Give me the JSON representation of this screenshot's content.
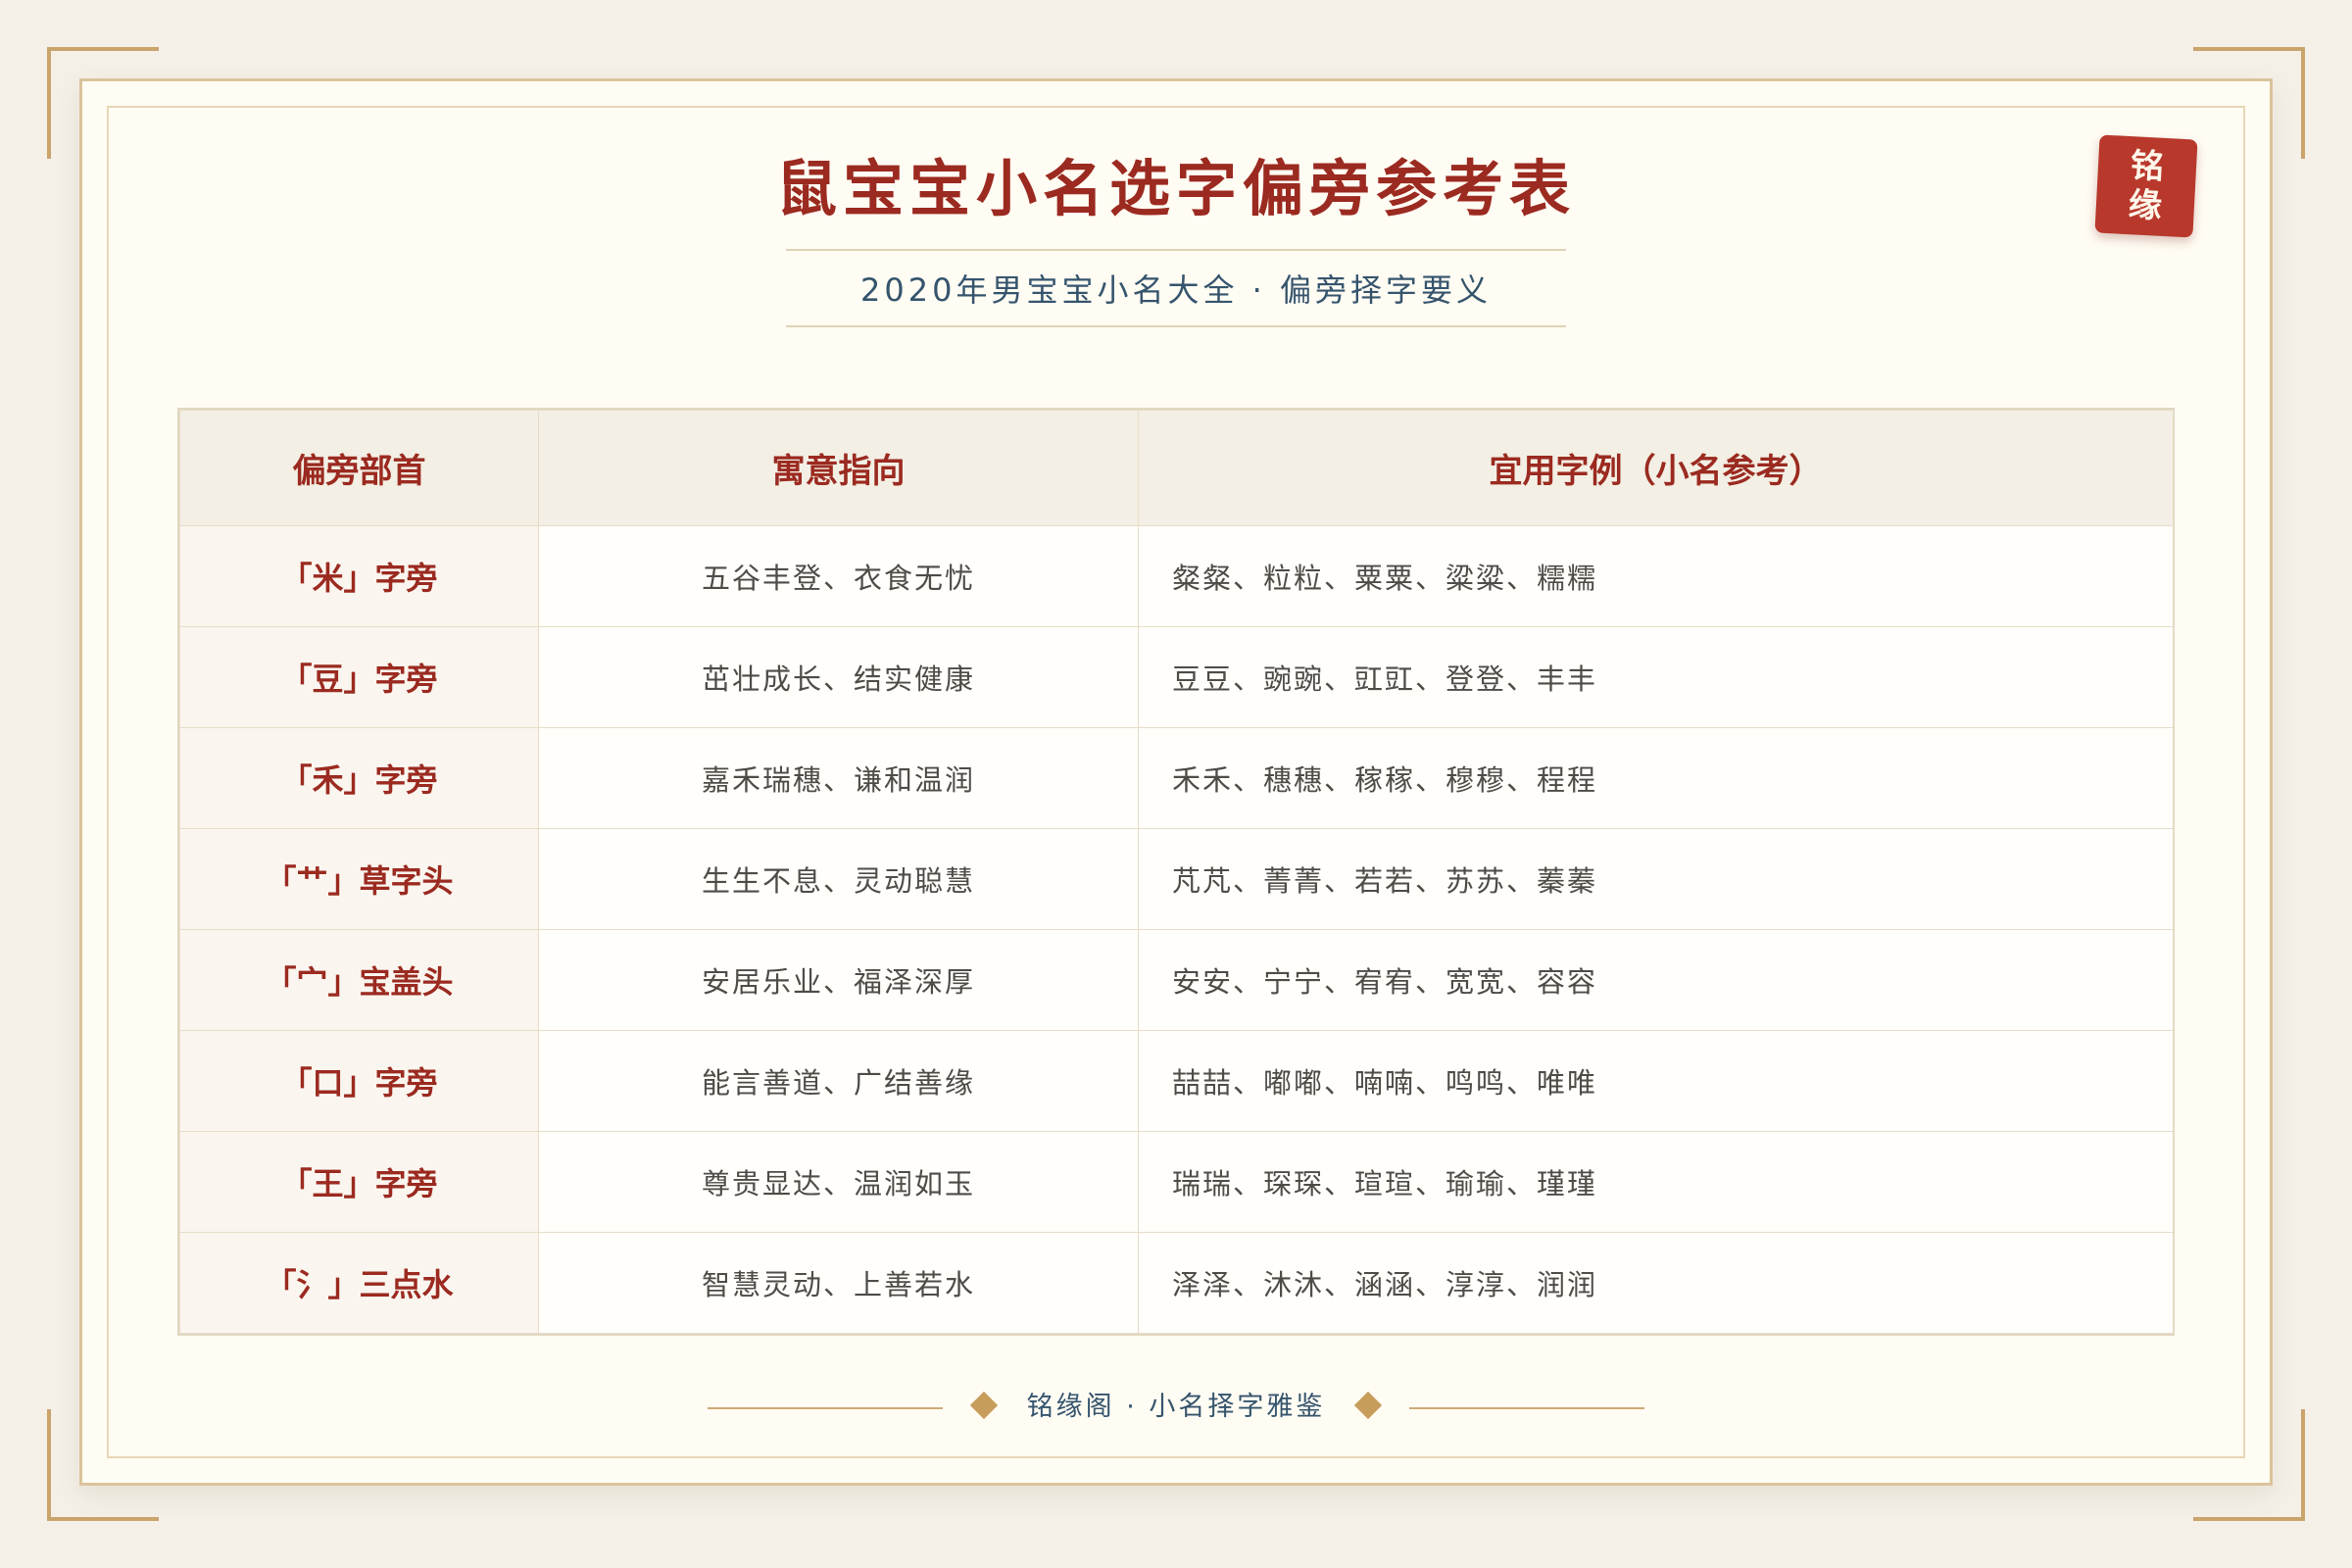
{
  "document": {
    "title": "鼠宝宝小名选字偏旁参考表",
    "subtitle": "2020年男宝宝小名大全 · 偏旁择字要义",
    "seal": {
      "line1": "铭",
      "line2": "缘"
    },
    "headers": {
      "radical": "偏旁部首",
      "meaning": "寓意指向",
      "examples": "宜用字例（小名参考）"
    },
    "rows": [
      {
        "radical": "「米」字旁",
        "meaning": "五谷丰登、衣食无忧",
        "examples": "粲粲、粒粒、粟粟、粱粱、糯糯"
      },
      {
        "radical": "「豆」字旁",
        "meaning": "茁壮成长、结实健康",
        "examples": "豆豆、豌豌、豇豇、登登、丰丰"
      },
      {
        "radical": "「禾」字旁",
        "meaning": "嘉禾瑞穗、谦和温润",
        "examples": "禾禾、穗穗、稼稼、穆穆、程程"
      },
      {
        "radical": "「艹」草字头",
        "meaning": "生生不息、灵动聪慧",
        "examples": "芃芃、菁菁、若若、苏苏、蓁蓁"
      },
      {
        "radical": "「宀」宝盖头",
        "meaning": "安居乐业、福泽深厚",
        "examples": "安安、宁宁、宥宥、宽宽、容容"
      },
      {
        "radical": "「口」字旁",
        "meaning": "能言善道、广结善缘",
        "examples": "喆喆、嘟嘟、喃喃、鸣鸣、唯唯"
      },
      {
        "radical": "「王」字旁",
        "meaning": "尊贵显达、温润如玉",
        "examples": "瑞瑞、琛琛、瑄瑄、瑜瑜、瑾瑾"
      },
      {
        "radical": "「氵」三点水",
        "meaning": "智慧灵动、上善若水",
        "examples": "泽泽、沐沐、涵涵、淳淳、润润"
      }
    ],
    "footer": "铭缘阁 · 小名择字雅鉴"
  },
  "colors": {
    "background": "#f4f0e7",
    "paper": "#fffcf3",
    "accent_red": "#9b2a20",
    "seal_red": "#b8382c",
    "gold": "#c9a46b",
    "blue_gray": "#35546d",
    "body_text": "#4f4b47"
  },
  "icons": {
    "footer_ornament": "diamond-icon"
  }
}
